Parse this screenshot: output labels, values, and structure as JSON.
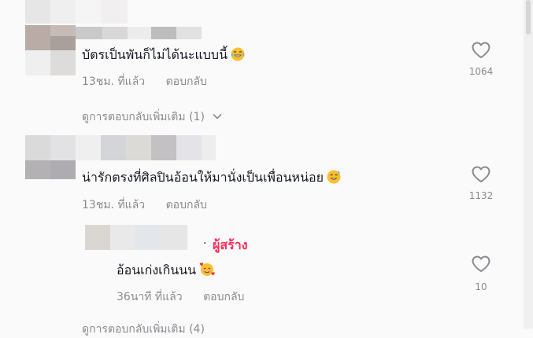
{
  "comments": [
    {
      "text": "บัตรเป็นพันก็ไม่ได้นะแบบนี้",
      "emoji": "laughing-tears-emoji",
      "time": "13ชม. ที่แล้ว",
      "reply_label": "ตอบกลับ",
      "likes": "1064",
      "view_replies": "ดูการตอบกลับเพิ่มเติม (1)"
    },
    {
      "text": "น่ารักตรงที่ศิลปินอ้อนให้มานั่งเป็นเพื่อนหน่อย",
      "emoji": "sweat-smile-emoji",
      "time": "13ชม. ที่แล้ว",
      "reply_label": "ตอบกลับ",
      "likes": "1132"
    }
  ],
  "reply": {
    "creator_tag": "ผู้สร้าง",
    "separator": "·",
    "text": "อ้อนเก่งเกินนน",
    "emoji": "smiling-hearts-emoji",
    "time": "36นาที ที่แล้ว",
    "reply_label": "ตอบกลับ",
    "likes": "10"
  },
  "bottom_link": "ดูการตอบกลับเพิ่มเติม (4)",
  "colors": {
    "creator": "#fe2c55",
    "muted": "#8a8b91",
    "text": "#161823"
  }
}
